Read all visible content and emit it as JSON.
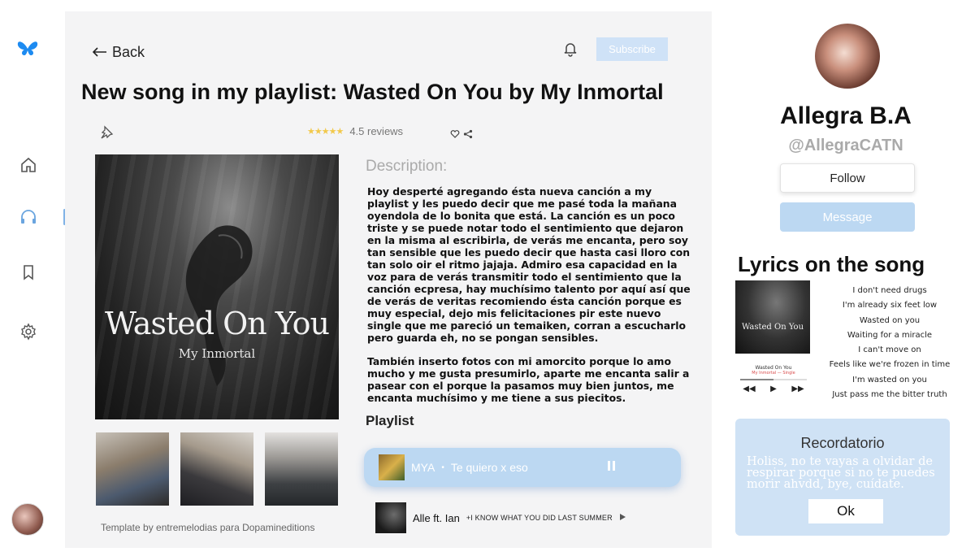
{
  "nav": {
    "icons": [
      "butterfly-logo-icon",
      "home-icon",
      "headphones-icon",
      "bookmark-icon",
      "gear-icon"
    ],
    "active": "headphones-icon"
  },
  "header": {
    "back_label": "Back",
    "subscribe_label": "Subscribe"
  },
  "post": {
    "title": "New song in my playlist: Wasted On You by My Inmortal",
    "reviews": "4.5 reviews",
    "stars": "★★★★★",
    "cover_title": "Wasted On You",
    "cover_artist": "My Inmortal",
    "description_heading": "Description:",
    "description_p1": "Hoy desperté agregando ésta nueva canción a my playlist y les puedo decir que me pasé toda la mañana oyendola de lo bonita que está. La canción es un poco triste y se puede notar todo el sentimiento que dejaron en la misma al escribirla, de verás me encanta, pero soy tan sensible que les puedo decir que hasta casi lloro con tan solo oir el ritmo jajaja. Admiro esa capacidad en la voz para de verás transmitir todo el sentimiento que la canción ecpresa, hay muchísimo talento por aquí así que de verás de veritas recomiendo ésta canción porque es muy especial, dejo mis felicitaciones pir este nuevo single que me pareció un temaiken, corran a escucharlo pero guarda eh, no se pongan sensibles.",
    "description_p2": "También inserto fotos con mi amorcito porque lo amo mucho y me gusta presumirlo, aparte me encanta salir a pasear con el porque la pasamos muy bien juntos, me encanta muchísimo y me tiene a sus piecitos.",
    "credit": "Template by entremelodias para Dopamineditions"
  },
  "playlist": {
    "heading": "Playlist",
    "tracks": [
      {
        "artist": "MYA",
        "separator": "•",
        "song": "Te quiero x eso"
      },
      {
        "artist": "Alle ft. Ian",
        "song": "+I KNOW WHAT YOU DID LAST SUMMER"
      }
    ]
  },
  "profile": {
    "name": "Allegra B.A",
    "handle": "@AllegraCATN",
    "follow_label": "Follow",
    "message_label": "Message"
  },
  "lyrics": {
    "heading": "Lyrics on the song",
    "mini_title": "Wasted On You",
    "mini_sub": "My Inmortal — Single",
    "lines": [
      "I don't need drugs",
      "I'm already six feet low",
      "Wasted on you",
      "Waiting for a miracle",
      "I can't move on",
      "Feels like we're frozen in time",
      "I'm wasted on you",
      "Just pass me the bitter truth"
    ]
  },
  "reminder": {
    "title": "Recordatorio",
    "text": "Holiss, no te vayas a olvidar de respirar porque si no te puedes morir ahvdd, bye, cuídate.",
    "ok_label": "Ok"
  },
  "colors": {
    "accent": "#bcd8f2",
    "accent_soft": "#cfe2f5",
    "star": "#f2c94c"
  }
}
